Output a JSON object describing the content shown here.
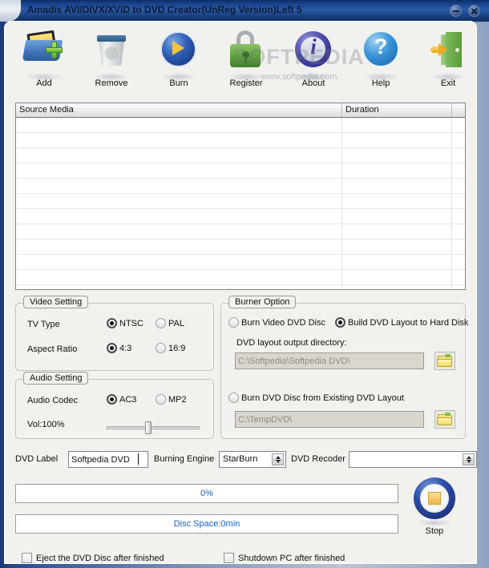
{
  "window": {
    "title": "Amadis AVI/DIVX/XVID to DVD Creator(UnReg Version)Left 5",
    "minimize_label": "minimize",
    "close_label": "close"
  },
  "watermark": {
    "big": "SOFTPEDIA",
    "small": "www.softpedia.com"
  },
  "toolbar": {
    "buttons": [
      {
        "label": "Add",
        "icon": "add-folder-film-icon"
      },
      {
        "label": "Remove",
        "icon": "trash-bin-icon"
      },
      {
        "label": "Burn",
        "icon": "play-disc-icon"
      },
      {
        "label": "Register",
        "icon": "padlock-icon"
      },
      {
        "label": "About",
        "icon": "info-icon"
      },
      {
        "label": "Help",
        "icon": "question-mark-icon"
      },
      {
        "label": "Exit",
        "icon": "exit-door-icon"
      }
    ]
  },
  "media_list": {
    "columns": [
      "Source Media",
      "Duration",
      ""
    ],
    "rows": []
  },
  "video_setting": {
    "legend": "Video Setting",
    "tv_type_label": "TV Type",
    "tv_type_options": [
      "NTSC",
      "PAL"
    ],
    "tv_type_selected": "NTSC",
    "aspect_label": "Aspect Ratio",
    "aspect_options": [
      "4:3",
      "16:9"
    ],
    "aspect_selected": "4:3"
  },
  "audio_setting": {
    "legend": "Audio Setting",
    "codec_label": "Audio Codec",
    "codec_options": [
      "AC3",
      "MP2"
    ],
    "codec_selected": "AC3",
    "volume_label": "Vol:100%",
    "volume_percent": 100,
    "slider_position_percent": 45
  },
  "burner_option": {
    "legend": "Burner Option",
    "mode_options": [
      "Burn Video DVD Disc",
      "Build DVD Layout to Hard Disk",
      "Burn DVD Disc from Existing DVD Layout"
    ],
    "mode_selected": "Build DVD Layout to Hard Disk",
    "output_dir_label": "DVD layout output directory:",
    "output_dir_value": "C:\\Softpedia\\Softpedia DVD\\",
    "existing_layout_value": "C:\\TempDVD\\",
    "browse_icon": "folder-browse-icon"
  },
  "bottom_fields": {
    "dvd_label_label": "DVD Label",
    "dvd_label_value": "Softpedia DVD",
    "burning_engine_label": "Burning Engine",
    "burning_engine_value": "StarBurn",
    "dvd_recorder_label": "DVD Recoder",
    "dvd_recorder_value": ""
  },
  "progress": {
    "percent_text": "0%",
    "percent_value": 0,
    "disc_space_text": "Disc Space:0min"
  },
  "stop_button": {
    "label": "Stop",
    "icon": "stop-square-icon"
  },
  "finish_options": {
    "eject_label": "Eject the DVD Disc after finished",
    "eject_checked": false,
    "shutdown_label": "Shutdown PC after finished",
    "shutdown_checked": false
  },
  "colors": {
    "titlebar": "#17418a",
    "client": "#f1f1ee",
    "progress_text": "#1a5fd0",
    "accent_green": "#5ba03c"
  }
}
